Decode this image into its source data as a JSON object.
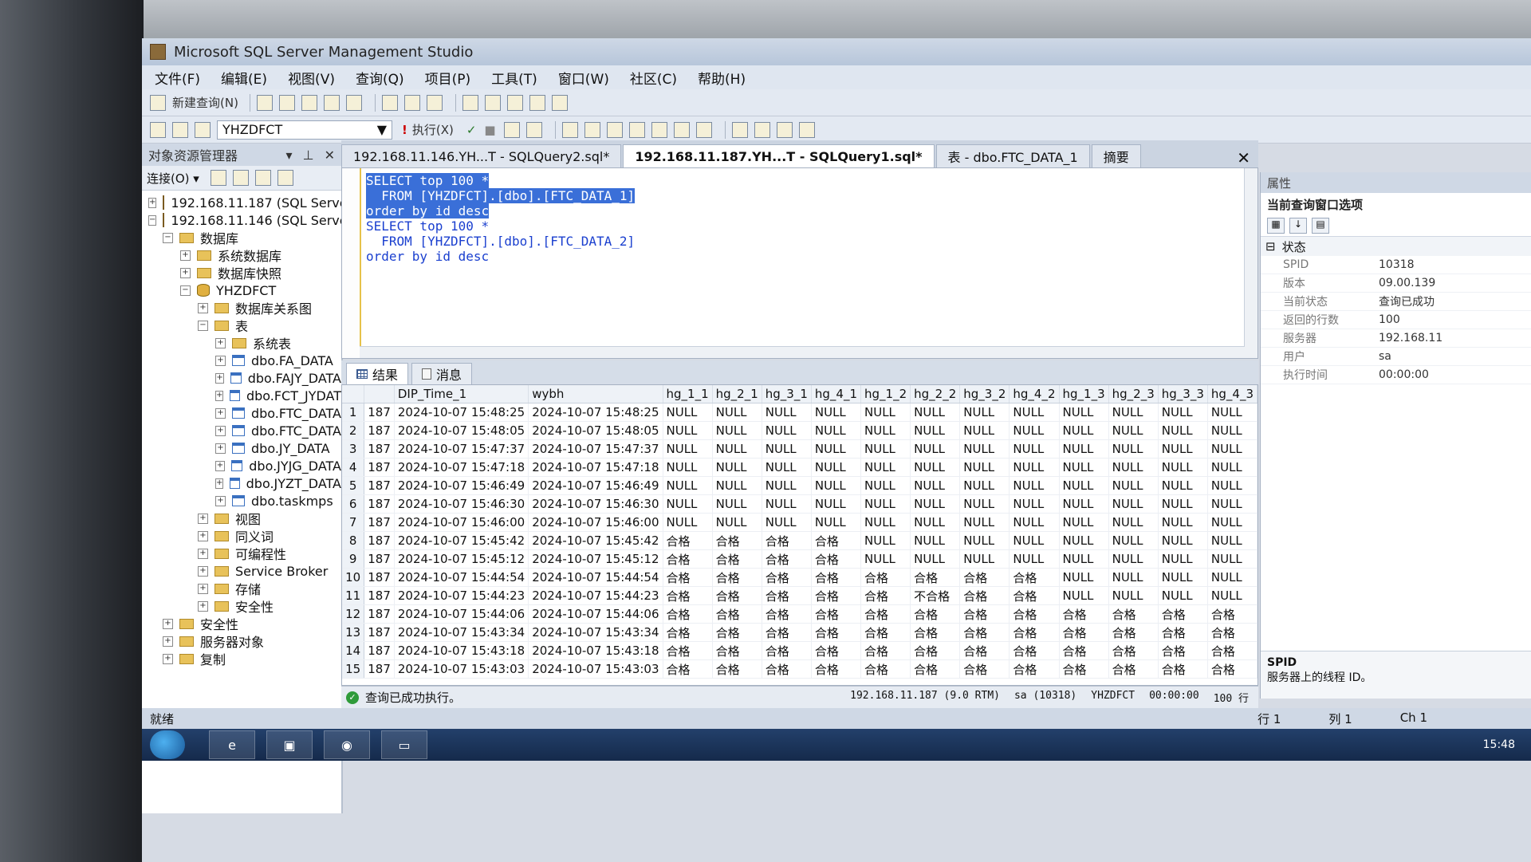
{
  "window": {
    "title": "Microsoft SQL Server Management Studio"
  },
  "menu": [
    "文件(F)",
    "编辑(E)",
    "视图(V)",
    "查询(Q)",
    "项目(P)",
    "工具(T)",
    "窗口(W)",
    "社区(C)",
    "帮助(H)"
  ],
  "toolbar": {
    "new_query_label": "新建查询(N)",
    "database": "YHZDFCT",
    "execute_label": "执行(X)"
  },
  "object_explorer": {
    "title": "对象资源管理器",
    "connect_label": "连接(O) ▾",
    "nodes": [
      {
        "label": "192.168.11.187 (SQL Server",
        "expander": "+",
        "icon": "server"
      },
      {
        "label": "192.168.11.146 (SQL Server",
        "expander": "−",
        "icon": "server"
      },
      {
        "label": "数据库",
        "expander": "−",
        "icon": "folder"
      },
      {
        "label": "系统数据库",
        "expander": "+",
        "icon": "folder"
      },
      {
        "label": "数据库快照",
        "expander": "+",
        "icon": "folder"
      },
      {
        "label": "YHZDFCT",
        "expander": "−",
        "icon": "database"
      },
      {
        "label": "数据库关系图",
        "expander": "+",
        "icon": "folder"
      },
      {
        "label": "表",
        "expander": "−",
        "icon": "folder"
      },
      {
        "label": "系统表",
        "expander": "+",
        "icon": "folder"
      },
      {
        "label": "dbo.FA_DATA",
        "expander": "+",
        "icon": "table"
      },
      {
        "label": "dbo.FAJY_DATA",
        "expander": "+",
        "icon": "table"
      },
      {
        "label": "dbo.FCT_JYDAT",
        "expander": "+",
        "icon": "table"
      },
      {
        "label": "dbo.FTC_DATA",
        "expander": "+",
        "icon": "table"
      },
      {
        "label": "dbo.FTC_DATA",
        "expander": "+",
        "icon": "table"
      },
      {
        "label": "dbo.JY_DATA",
        "expander": "+",
        "icon": "table"
      },
      {
        "label": "dbo.JYJG_DATA",
        "expander": "+",
        "icon": "table"
      },
      {
        "label": "dbo.JYZT_DATA",
        "expander": "+",
        "icon": "table"
      },
      {
        "label": "dbo.taskmps",
        "expander": "+",
        "icon": "table"
      },
      {
        "label": "视图",
        "expander": "+",
        "icon": "folder"
      },
      {
        "label": "同义词",
        "expander": "+",
        "icon": "folder"
      },
      {
        "label": "可编程性",
        "expander": "+",
        "icon": "folder"
      },
      {
        "label": "Service Broker",
        "expander": "+",
        "icon": "folder"
      },
      {
        "label": "存储",
        "expander": "+",
        "icon": "folder"
      },
      {
        "label": "安全性",
        "expander": "+",
        "icon": "folder"
      },
      {
        "label": "安全性",
        "expander": "+",
        "icon": "folder"
      },
      {
        "label": "服务器对象",
        "expander": "+",
        "icon": "folder"
      },
      {
        "label": "复制",
        "expander": "+",
        "icon": "folder"
      }
    ]
  },
  "tabs": [
    {
      "label": "192.168.11.146.YH...T - SQLQuery2.sql*"
    },
    {
      "label": "192.168.11.187.YH...T - SQLQuery1.sql*"
    },
    {
      "label": "表 - dbo.FTC_DATA_1"
    },
    {
      "label": "摘要"
    }
  ],
  "editor": {
    "lines": [
      {
        "text": "SELECT top 100 *",
        "selected": true
      },
      {
        "text": "  FROM [YHZDFCT].[dbo].[FTC_DATA_1]",
        "selected": true
      },
      {
        "text": "order by id desc",
        "selected": true
      },
      {
        "text": "",
        "selected": false
      },
      {
        "text": "SELECT top 100 *",
        "selected": false
      },
      {
        "text": "  FROM [YHZDFCT].[dbo].[FTC_DATA_2]",
        "selected": false
      },
      {
        "text": "order by id desc",
        "selected": false
      }
    ]
  },
  "results": {
    "tab_results": "结果",
    "tab_messages": "消息",
    "columns": [
      "",
      "",
      "DIP_Time_1",
      "wybh",
      "hg_1_1",
      "hg_2_1",
      "hg_3_1",
      "hg_4_1",
      "hg_1_2",
      "hg_2_2",
      "hg_3_2",
      "hg_4_2",
      "hg_1_3",
      "hg_2_3",
      "hg_3_3",
      "hg_4_3"
    ],
    "rows": [
      [
        "1",
        "187",
        "2024-10-07 15:48:25",
        "2024-10-07 15:48:25",
        "NULL",
        "NULL",
        "NULL",
        "NULL",
        "NULL",
        "NULL",
        "NULL",
        "NULL",
        "NULL",
        "NULL",
        "NULL",
        "NULL"
      ],
      [
        "2",
        "187",
        "2024-10-07 15:48:05",
        "2024-10-07 15:48:05",
        "NULL",
        "NULL",
        "NULL",
        "NULL",
        "NULL",
        "NULL",
        "NULL",
        "NULL",
        "NULL",
        "NULL",
        "NULL",
        "NULL"
      ],
      [
        "3",
        "187",
        "2024-10-07 15:47:37",
        "2024-10-07 15:47:37",
        "NULL",
        "NULL",
        "NULL",
        "NULL",
        "NULL",
        "NULL",
        "NULL",
        "NULL",
        "NULL",
        "NULL",
        "NULL",
        "NULL"
      ],
      [
        "4",
        "187",
        "2024-10-07 15:47:18",
        "2024-10-07 15:47:18",
        "NULL",
        "NULL",
        "NULL",
        "NULL",
        "NULL",
        "NULL",
        "NULL",
        "NULL",
        "NULL",
        "NULL",
        "NULL",
        "NULL"
      ],
      [
        "5",
        "187",
        "2024-10-07 15:46:49",
        "2024-10-07 15:46:49",
        "NULL",
        "NULL",
        "NULL",
        "NULL",
        "NULL",
        "NULL",
        "NULL",
        "NULL",
        "NULL",
        "NULL",
        "NULL",
        "NULL"
      ],
      [
        "6",
        "187",
        "2024-10-07 15:46:30",
        "2024-10-07 15:46:30",
        "NULL",
        "NULL",
        "NULL",
        "NULL",
        "NULL",
        "NULL",
        "NULL",
        "NULL",
        "NULL",
        "NULL",
        "NULL",
        "NULL"
      ],
      [
        "7",
        "187",
        "2024-10-07 15:46:00",
        "2024-10-07 15:46:00",
        "NULL",
        "NULL",
        "NULL",
        "NULL",
        "NULL",
        "NULL",
        "NULL",
        "NULL",
        "NULL",
        "NULL",
        "NULL",
        "NULL"
      ],
      [
        "8",
        "187",
        "2024-10-07 15:45:42",
        "2024-10-07 15:45:42",
        "合格",
        "合格",
        "合格",
        "合格",
        "NULL",
        "NULL",
        "NULL",
        "NULL",
        "NULL",
        "NULL",
        "NULL",
        "NULL"
      ],
      [
        "9",
        "187",
        "2024-10-07 15:45:12",
        "2024-10-07 15:45:12",
        "合格",
        "合格",
        "合格",
        "合格",
        "NULL",
        "NULL",
        "NULL",
        "NULL",
        "NULL",
        "NULL",
        "NULL",
        "NULL"
      ],
      [
        "10",
        "187",
        "2024-10-07 15:44:54",
        "2024-10-07 15:44:54",
        "合格",
        "合格",
        "合格",
        "合格",
        "合格",
        "合格",
        "合格",
        "合格",
        "NULL",
        "NULL",
        "NULL",
        "NULL"
      ],
      [
        "11",
        "187",
        "2024-10-07 15:44:23",
        "2024-10-07 15:44:23",
        "合格",
        "合格",
        "合格",
        "合格",
        "合格",
        "不合格",
        "合格",
        "合格",
        "NULL",
        "NULL",
        "NULL",
        "NULL"
      ],
      [
        "12",
        "187",
        "2024-10-07 15:44:06",
        "2024-10-07 15:44:06",
        "合格",
        "合格",
        "合格",
        "合格",
        "合格",
        "合格",
        "合格",
        "合格",
        "合格",
        "合格",
        "合格",
        "合格"
      ],
      [
        "13",
        "187",
        "2024-10-07 15:43:34",
        "2024-10-07 15:43:34",
        "合格",
        "合格",
        "合格",
        "合格",
        "合格",
        "合格",
        "合格",
        "合格",
        "合格",
        "合格",
        "合格",
        "合格"
      ],
      [
        "14",
        "187",
        "2024-10-07 15:43:18",
        "2024-10-07 15:43:18",
        "合格",
        "合格",
        "合格",
        "合格",
        "合格",
        "合格",
        "合格",
        "合格",
        "合格",
        "合格",
        "合格",
        "合格"
      ],
      [
        "15",
        "187",
        "2024-10-07 15:43:03",
        "2024-10-07 15:43:03",
        "合格",
        "合格",
        "合格",
        "合格",
        "合格",
        "合格",
        "合格",
        "合格",
        "合格",
        "合格",
        "合格",
        "合格"
      ]
    ]
  },
  "query_status": {
    "message": "查询已成功执行。",
    "server": "192.168.11.187 (9.0 RTM)",
    "user": "sa (10318)",
    "database": "YHZDFCT",
    "elapsed": "00:00:00",
    "rows": "100 行"
  },
  "properties": {
    "title": "属性",
    "subtitle": "当前查询窗口选项",
    "category": "状态",
    "items": [
      {
        "key": "SPID",
        "value": "10318"
      },
      {
        "key": "版本",
        "value": "09.00.139"
      },
      {
        "key": "当前状态",
        "value": "查询已成功"
      },
      {
        "key": "返回的行数",
        "value": "100"
      },
      {
        "key": "服务器",
        "value": "192.168.11"
      },
      {
        "key": "用户",
        "value": "sa"
      },
      {
        "key": "执行时间",
        "value": "00:00:00"
      }
    ],
    "desc_title": "SPID",
    "desc_text": "服务器上的线程 ID。"
  },
  "app_status": {
    "ready": "就绪",
    "row": "行 1",
    "col": "列 1",
    "ch": "Ch 1"
  },
  "taskbar": {
    "clock": "15:48"
  }
}
